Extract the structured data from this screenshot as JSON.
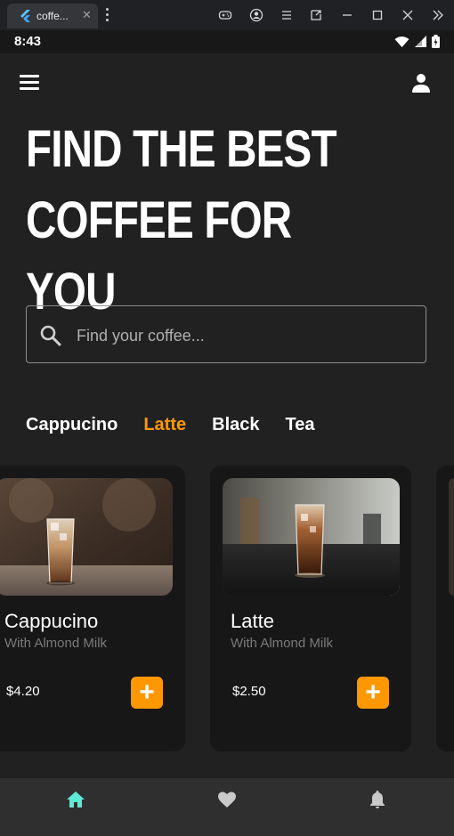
{
  "browser": {
    "tab_title": "coffe...",
    "tab_close": "✕"
  },
  "status_bar": {
    "time": "8:43"
  },
  "hero": {
    "line1": "FIND THE BEST",
    "line2": "COFFEE FOR YOU"
  },
  "search": {
    "placeholder": "Find your coffee..."
  },
  "categories": [
    "Cappucino",
    "Latte",
    "Black",
    "Tea"
  ],
  "active_category": "Latte",
  "products": [
    {
      "name": "Cappucino",
      "subtitle": "With Almond Milk",
      "price": "$4.20",
      "add_label": "+"
    },
    {
      "name": "Latte",
      "subtitle": "With Almond Milk",
      "price": "$2.50",
      "add_label": "+"
    }
  ],
  "bottom_nav": {
    "items": [
      "home-icon",
      "heart-icon",
      "bell-icon"
    ],
    "active": "home-icon"
  },
  "colors": {
    "background": "#212121",
    "card": "#171717",
    "accent": "#ff9800",
    "nav_active": "#5eead4",
    "nav_inactive": "#c9c9c9"
  }
}
